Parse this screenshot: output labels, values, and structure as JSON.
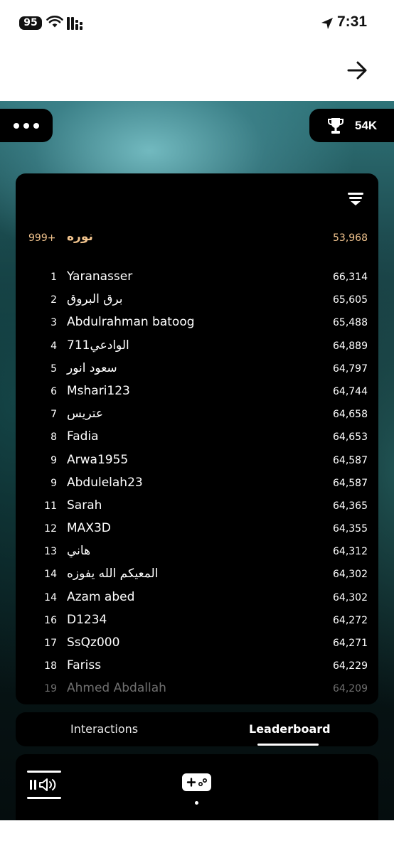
{
  "status": {
    "battery": "95",
    "time": "7:31"
  },
  "header": {
    "score": "54K"
  },
  "my_entry": {
    "rank": "999+",
    "name": "نوره",
    "score": "53,968"
  },
  "leaderboard": [
    {
      "rank": "1",
      "name": "Yaranasser",
      "score": "66,314"
    },
    {
      "rank": "2",
      "name": "برق البروق",
      "score": "65,605"
    },
    {
      "rank": "3",
      "name": "Abdulrahman batoog",
      "score": "65,488"
    },
    {
      "rank": "4",
      "name": "الوادعي711",
      "score": "64,889"
    },
    {
      "rank": "5",
      "name": "سعود انور",
      "score": "64,797"
    },
    {
      "rank": "6",
      "name": "Mshari123",
      "score": "64,744"
    },
    {
      "rank": "7",
      "name": "عتريس",
      "score": "64,658"
    },
    {
      "rank": "8",
      "name": "Fadia",
      "score": "64,653"
    },
    {
      "rank": "9",
      "name": "Arwa1955",
      "score": "64,587"
    },
    {
      "rank": "9",
      "name": "Abdulelah23",
      "score": "64,587"
    },
    {
      "rank": "11",
      "name": "Sarah",
      "score": "64,365"
    },
    {
      "rank": "12",
      "name": "MAX3D",
      "score": "64,355"
    },
    {
      "rank": "13",
      "name": "هاني",
      "score": "64,312"
    },
    {
      "rank": "14",
      "name": "المعيكم الله يفوزه",
      "score": "64,302"
    },
    {
      "rank": "14",
      "name": "Azam abed",
      "score": "64,302"
    },
    {
      "rank": "16",
      "name": "D1234",
      "score": "64,272"
    },
    {
      "rank": "17",
      "name": "SsQz000",
      "score": "64,271"
    },
    {
      "rank": "18",
      "name": "Fariss",
      "score": "64,229"
    },
    {
      "rank": "19",
      "name": "Ahmed Abdallah",
      "score": "64,209"
    }
  ],
  "tabs": {
    "interactions": "Interactions",
    "leaderboard": "Leaderboard",
    "active": "leaderboard"
  },
  "colors": {
    "highlight": "#f2c48e",
    "panel": "#000000",
    "teal": "#5fb2b8"
  }
}
